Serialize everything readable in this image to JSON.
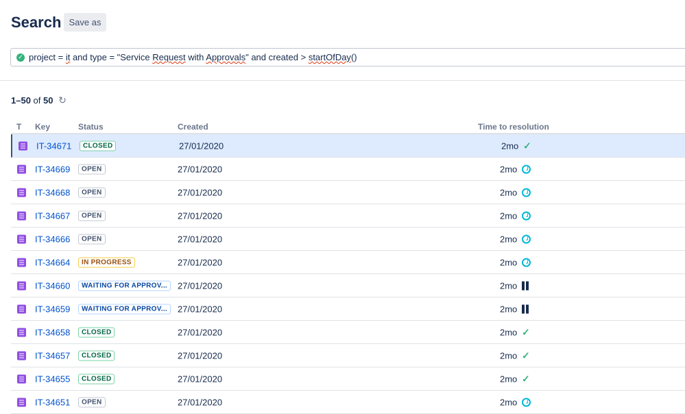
{
  "header": {
    "title": "Search",
    "save_as": "Save as"
  },
  "query": {
    "parts": [
      "project = ",
      "it",
      " and type = \"Service ",
      "Request",
      " with ",
      "Approvals",
      "\" and created > ",
      "startOfDay",
      "()"
    ]
  },
  "results": {
    "range": "1–50",
    "of": "of",
    "total": "50"
  },
  "columns": {
    "type": "T",
    "key": "Key",
    "status": "Status",
    "created": "Created",
    "ttr": "Time to resolution"
  },
  "rows": [
    {
      "key": "IT-34671",
      "status": "CLOSED",
      "kind": "closed",
      "created": "27/01/2020",
      "ttr": "2mo",
      "icon": "check"
    },
    {
      "key": "IT-34669",
      "status": "OPEN",
      "kind": "open",
      "created": "27/01/2020",
      "ttr": "2mo",
      "icon": "clock"
    },
    {
      "key": "IT-34668",
      "status": "OPEN",
      "kind": "open",
      "created": "27/01/2020",
      "ttr": "2mo",
      "icon": "clock"
    },
    {
      "key": "IT-34667",
      "status": "OPEN",
      "kind": "open",
      "created": "27/01/2020",
      "ttr": "2mo",
      "icon": "clock"
    },
    {
      "key": "IT-34666",
      "status": "OPEN",
      "kind": "open",
      "created": "27/01/2020",
      "ttr": "2mo",
      "icon": "clock"
    },
    {
      "key": "IT-34664",
      "status": "IN PROGRESS",
      "kind": "prog",
      "created": "27/01/2020",
      "ttr": "2mo",
      "icon": "clock"
    },
    {
      "key": "IT-34660",
      "status": "WAITING FOR APPROV...",
      "kind": "wait",
      "created": "27/01/2020",
      "ttr": "2mo",
      "icon": "pause"
    },
    {
      "key": "IT-34659",
      "status": "WAITING FOR APPROV...",
      "kind": "wait",
      "created": "27/01/2020",
      "ttr": "2mo",
      "icon": "pause"
    },
    {
      "key": "IT-34658",
      "status": "CLOSED",
      "kind": "closed",
      "created": "27/01/2020",
      "ttr": "2mo",
      "icon": "check"
    },
    {
      "key": "IT-34657",
      "status": "CLOSED",
      "kind": "closed",
      "created": "27/01/2020",
      "ttr": "2mo",
      "icon": "check"
    },
    {
      "key": "IT-34655",
      "status": "CLOSED",
      "kind": "closed",
      "created": "27/01/2020",
      "ttr": "2mo",
      "icon": "check"
    },
    {
      "key": "IT-34651",
      "status": "OPEN",
      "kind": "open",
      "created": "27/01/2020",
      "ttr": "2mo",
      "icon": "clock"
    }
  ]
}
